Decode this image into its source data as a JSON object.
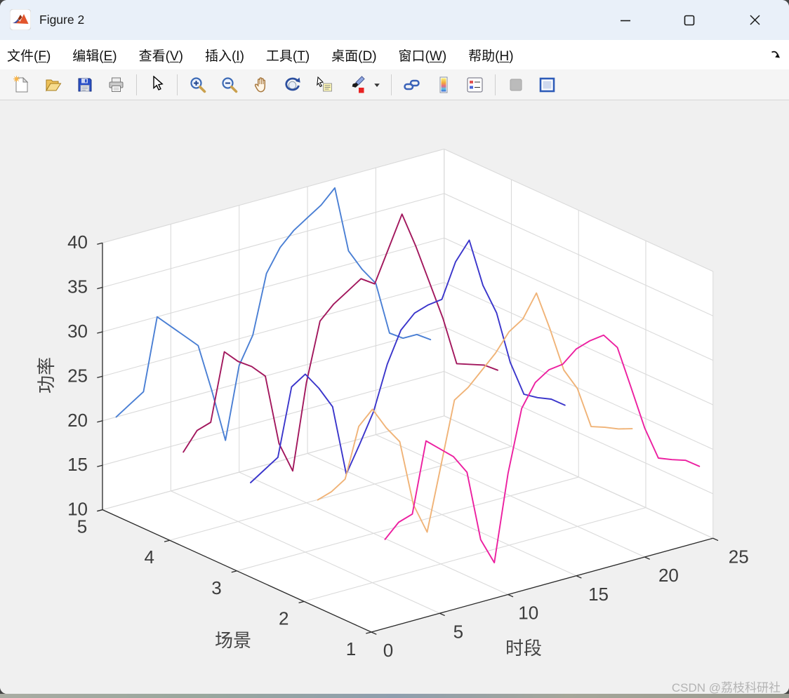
{
  "window": {
    "title": "Figure 2",
    "icon": "matlab-logo-icon",
    "controls": [
      "minimize",
      "maximize",
      "close"
    ]
  },
  "menu": {
    "items": [
      "文件(F)",
      "编辑(E)",
      "查看(V)",
      "插入(I)",
      "工具(T)",
      "桌面(D)",
      "窗口(W)",
      "帮助(H)"
    ],
    "overflow_icon": "dock-arrow-icon"
  },
  "toolbar": {
    "icons": [
      "new-figure",
      "open-file",
      "save-figure",
      "print-figure",
      "separator",
      "edit-cursor",
      "separator",
      "zoom-in",
      "zoom-out",
      "pan",
      "rotate-3d",
      "data-cursor",
      "brush-data",
      "brush-dropdown",
      "separator",
      "link-plots",
      "insert-colorbar",
      "insert-legend",
      "separator",
      "plot-tools-off",
      "dock-figure"
    ]
  },
  "chart_data": {
    "type": "line3d",
    "xlabel": "时段",
    "ylabel": "场景",
    "zlabel": "功率",
    "xlim": [
      0,
      25
    ],
    "ylim": [
      1,
      5
    ],
    "zlim": [
      10,
      40
    ],
    "xticks": [
      0,
      5,
      10,
      15,
      20,
      25
    ],
    "yticks": [
      1,
      2,
      3,
      4,
      5
    ],
    "zticks": [
      10,
      15,
      20,
      25,
      30,
      35,
      40
    ],
    "grid": true,
    "x": [
      1,
      2,
      3,
      4,
      5,
      6,
      7,
      8,
      9,
      10,
      11,
      12,
      13,
      14,
      15,
      16,
      17,
      18,
      19,
      20,
      21,
      22,
      23,
      24
    ],
    "series": [
      {
        "scene": 5,
        "color": "#4a7fd4",
        "values": [
          20,
          21,
          22,
          30,
          28.5,
          27,
          25.5,
          20,
          14,
          22,
          25,
          31.5,
          34,
          35.5,
          36.5,
          37.5,
          39,
          31.5,
          29,
          27,
          21,
          20,
          20,
          19
        ]
      },
      {
        "scene": 4,
        "color": "#a2175d",
        "values": [
          19.5,
          21.5,
          22,
          29.5,
          28,
          27,
          25.5,
          17.5,
          14,
          23.5,
          30,
          31.5,
          32.5,
          33.5,
          32.5,
          36,
          39.5,
          35.5,
          31,
          26.5,
          21,
          20.5,
          20,
          19
        ]
      },
      {
        "scene": 3,
        "color": "#3a35cb",
        "values": [
          19.5,
          20.5,
          21.5,
          29,
          30,
          28,
          25.5,
          17.5,
          20.5,
          23.7,
          28.6,
          32,
          33.5,
          34,
          34.2,
          38,
          40,
          34.5,
          31,
          25,
          21,
          20.2,
          19.6,
          18.5
        ]
      },
      {
        "scene": 2,
        "color": "#f0b377",
        "values": [
          21,
          21.5,
          22.5,
          28,
          29.5,
          27,
          25,
          17.5,
          14,
          21,
          28,
          29,
          30.5,
          32,
          34,
          35,
          37.5,
          33,
          28,
          25.5,
          20.8,
          20.3,
          19.7,
          19.3
        ]
      },
      {
        "scene": 1,
        "color": "#ec1fa0",
        "values": [
          20,
          21.5,
          22,
          29.8,
          28.5,
          27.2,
          25,
          17,
          14,
          23.6,
          30.5,
          33,
          34,
          34.2,
          35.5,
          36,
          36.2,
          34.4,
          29.5,
          24.5,
          20.7,
          20.1,
          19.6,
          18.5
        ]
      }
    ]
  },
  "watermark": {
    "text": "CSDN @荔枝科研社"
  }
}
